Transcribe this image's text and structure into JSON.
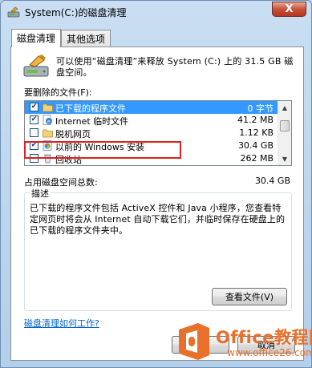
{
  "window": {
    "title": "System(C:)的磁盘清理",
    "close_glyph": "X"
  },
  "tabs": [
    {
      "label": "磁盘清理",
      "active": true
    },
    {
      "label": "其他选项",
      "active": false
    }
  ],
  "intro_text": "可以使用“磁盘清理”来释放 System (C:) 上的 31.5 GB 磁盘空间。",
  "files_label": "要删除的文件(F):",
  "files": [
    {
      "checked": true,
      "icon": "folder-icon",
      "name": "已下载的程序文件",
      "size": "0 字节",
      "selected": true
    },
    {
      "checked": true,
      "icon": "ie-icon",
      "name": "Internet 临时文件",
      "size": "41.2 MB",
      "selected": false
    },
    {
      "checked": false,
      "icon": "offline-page-icon",
      "name": "脱机网页",
      "size": "1.12 KB",
      "selected": false
    },
    {
      "checked": true,
      "icon": "windows-setup-icon",
      "name": "以前的 Windows 安装",
      "size": "30.4 GB",
      "selected": false
    },
    {
      "checked": false,
      "icon": "recycle-bin-icon",
      "name": "回收站",
      "size": "262 MB",
      "selected": false
    }
  ],
  "total": {
    "label": "占用磁盘空间总数:",
    "value": "30.4 GB"
  },
  "description": {
    "title": "描述",
    "text": "已下载的程序文件包括 ActiveX 控件和 Java 小程序，您查看特定网页时将会从 Internet 自动下载它们，并临时保存在硬盘上的已下载的程序文件夹中。"
  },
  "view_files_button": "查看文件(V)",
  "help_link": "磁盘清理如何工作?",
  "buttons": {
    "ok": "确定",
    "cancel": "取消"
  },
  "watermark": {
    "line1": "Office教程网",
    "line2": "www.office26.com"
  },
  "colors": {
    "selection": "#3399ff",
    "highlight_border": "#e02020",
    "link": "#0066cc",
    "watermark": "#e8702a"
  }
}
